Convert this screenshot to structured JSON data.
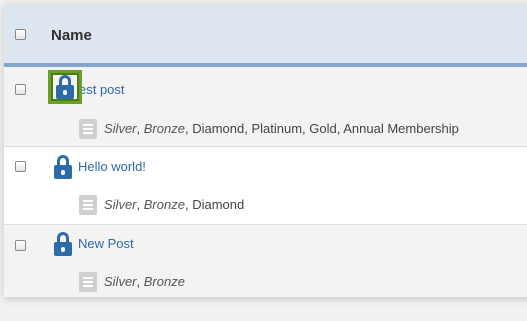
{
  "table": {
    "header": {
      "name_label": "Name"
    },
    "rows": [
      {
        "title": "Test post",
        "visible_title": "est post",
        "levels": [
          {
            "label": "Silver",
            "italic": true
          },
          {
            "label": "Bronze",
            "italic": true
          },
          {
            "label": "Diamond",
            "italic": false
          },
          {
            "label": "Platinum",
            "italic": false
          },
          {
            "label": "Gold",
            "italic": false
          },
          {
            "label": "Annual Membership",
            "italic": false
          }
        ]
      },
      {
        "title": "Hello world!",
        "levels": [
          {
            "label": "Silver",
            "italic": true
          },
          {
            "label": "Bronze",
            "italic": true
          },
          {
            "label": "Diamond",
            "italic": false
          }
        ]
      },
      {
        "title": "New Post",
        "levels": [
          {
            "label": "Silver",
            "italic": true
          },
          {
            "label": "Bronze",
            "italic": true
          }
        ]
      }
    ]
  },
  "icons": {
    "lock": "lock-icon",
    "document": "document-icon",
    "checkbox": "checkbox"
  },
  "colors": {
    "header_bg": "#dde5ef",
    "header_border": "#85a7cf",
    "link": "#2d6aa8",
    "highlight": "#68a02a"
  }
}
